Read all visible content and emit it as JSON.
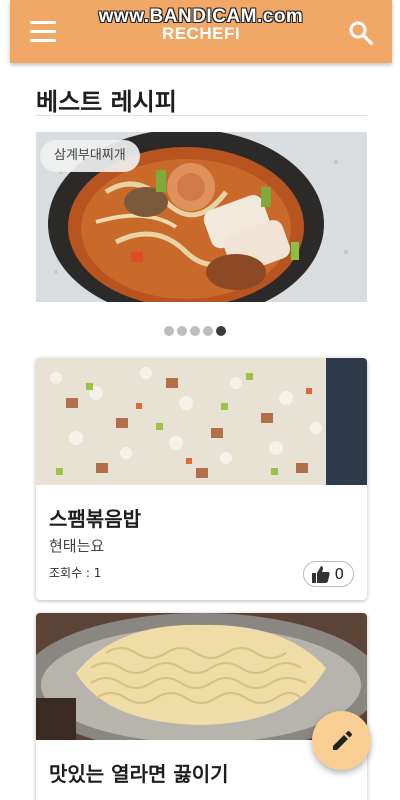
{
  "watermark": "www.BANDICAM.com",
  "appbar": {
    "title": "RECHEFI",
    "menu_icon": "menu-icon",
    "search_icon": "search-icon"
  },
  "section": {
    "title": "베스트 레시피"
  },
  "carousel": {
    "label": "삼계부대찌개",
    "slide_count": 5,
    "active_index": 4
  },
  "recipes": [
    {
      "title": "스팸볶음밥",
      "author": "현태는요",
      "views": "조회수 : 1",
      "likes": "0"
    },
    {
      "title": "맛있는 열라면 끓이기"
    }
  ],
  "fab": {
    "icon": "pencil-icon"
  },
  "colors": {
    "appbar": "#f1a766",
    "fab": "#f9cf93",
    "dot_active": "#3a3a3a",
    "dot_inactive": "#bdbdbd"
  }
}
